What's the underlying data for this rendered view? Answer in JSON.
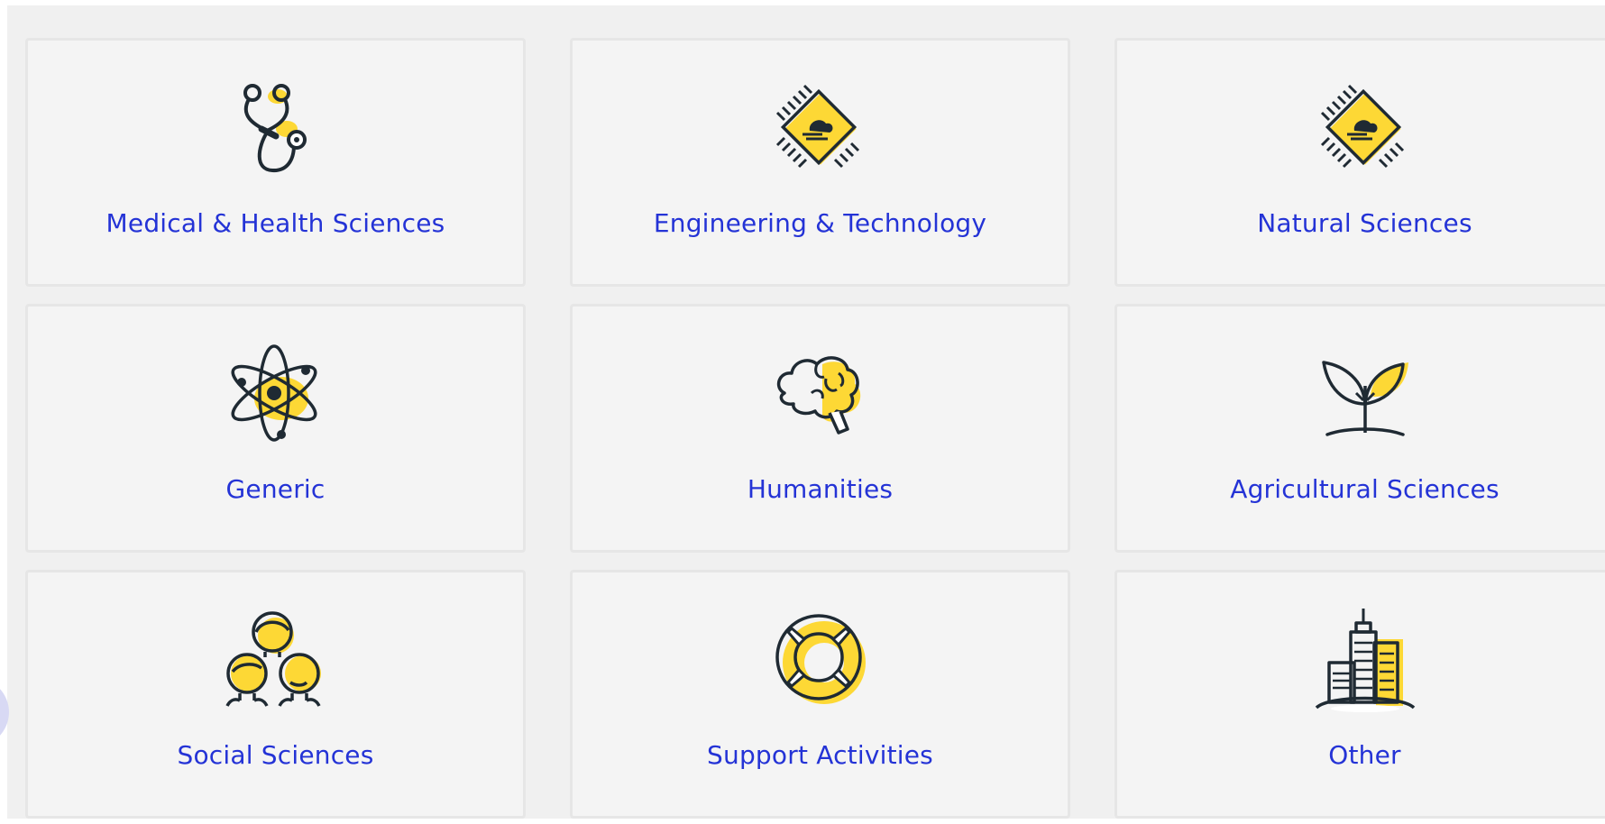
{
  "categories": [
    {
      "label": "Medical & Health Sciences",
      "icon": "stethoscope-icon"
    },
    {
      "label": "Engineering & Technology",
      "icon": "chip-icon"
    },
    {
      "label": "Natural Sciences",
      "icon": "chip-icon"
    },
    {
      "label": "Generic",
      "icon": "atom-icon"
    },
    {
      "label": "Humanities",
      "icon": "brain-icon"
    },
    {
      "label": "Agricultural Sciences",
      "icon": "sprout-icon"
    },
    {
      "label": "Social Sciences",
      "icon": "people-icon"
    },
    {
      "label": "Support Activities",
      "icon": "lifebuoy-icon"
    },
    {
      "label": "Other",
      "icon": "buildings-icon"
    }
  ],
  "colors": {
    "accent": "#fdd835",
    "label": "#2433d6",
    "stroke": "#1f2a33",
    "card_bg": "#f4f4f4",
    "card_border": "#e6e6e6",
    "panel_bg": "#f0f0f0"
  }
}
